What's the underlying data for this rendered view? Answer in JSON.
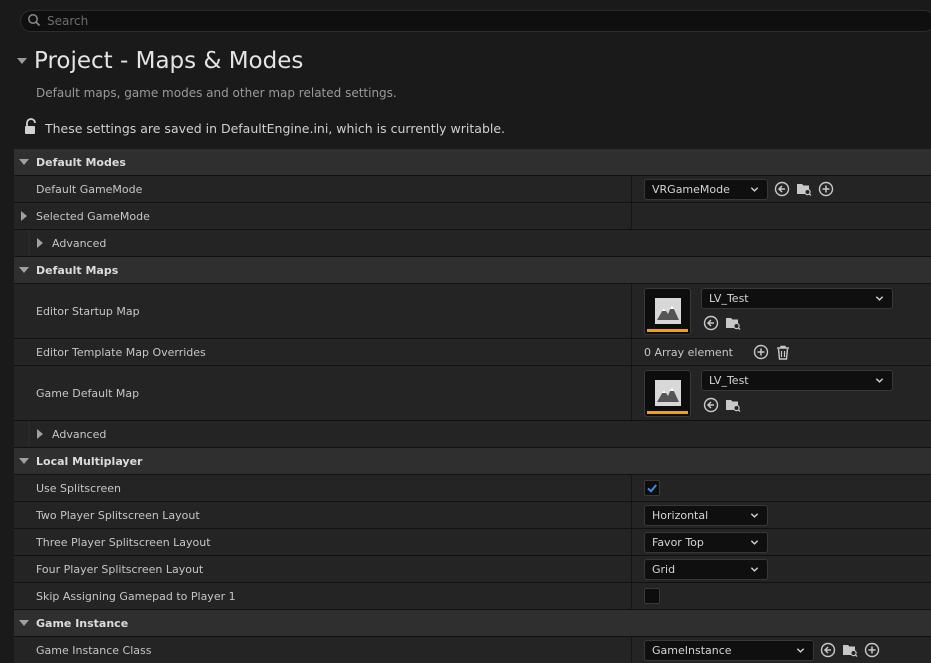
{
  "search": {
    "placeholder": "Search"
  },
  "header": {
    "title": "Project - Maps & Modes",
    "description": "Default maps, game modes and other map related settings.",
    "writable_notice": "These settings are saved in DefaultEngine.ini, which is currently writable."
  },
  "sections": {
    "default_modes": {
      "label": "Default Modes",
      "default_gamemode": {
        "label": "Default GameMode",
        "value": "VRGameMode"
      },
      "selected_gamemode": {
        "label": "Selected GameMode"
      },
      "advanced": {
        "label": "Advanced"
      }
    },
    "default_maps": {
      "label": "Default Maps",
      "editor_startup_map": {
        "label": "Editor Startup Map",
        "value": "LV_Test"
      },
      "editor_template_overrides": {
        "label": "Editor Template Map Overrides",
        "value": "0 Array element"
      },
      "game_default_map": {
        "label": "Game Default Map",
        "value": "LV_Test"
      },
      "advanced": {
        "label": "Advanced"
      }
    },
    "local_multiplayer": {
      "label": "Local Multiplayer",
      "use_splitscreen": {
        "label": "Use Splitscreen",
        "checked": true
      },
      "two_player": {
        "label": "Two Player Splitscreen Layout",
        "value": "Horizontal"
      },
      "three_player": {
        "label": "Three Player Splitscreen Layout",
        "value": "Favor Top"
      },
      "four_player": {
        "label": "Four Player Splitscreen Layout",
        "value": "Grid"
      },
      "skip_gamepad": {
        "label": "Skip Assigning Gamepad to Player 1",
        "checked": false
      }
    },
    "game_instance": {
      "label": "Game Instance",
      "game_instance_class": {
        "label": "Game Instance Class",
        "value": "GameInstance"
      }
    }
  },
  "colors": {
    "accent": "#e8a317",
    "highlight_box": "#e8111d",
    "checkbox_check": "#3a8ee6"
  },
  "icons": [
    "search-icon",
    "unlock-icon",
    "reset-arrow-icon",
    "browse-folder-icon",
    "add-icon",
    "trash-icon",
    "chevron-down-icon",
    "map-thumbnail-icon",
    "checkmark-icon"
  ]
}
